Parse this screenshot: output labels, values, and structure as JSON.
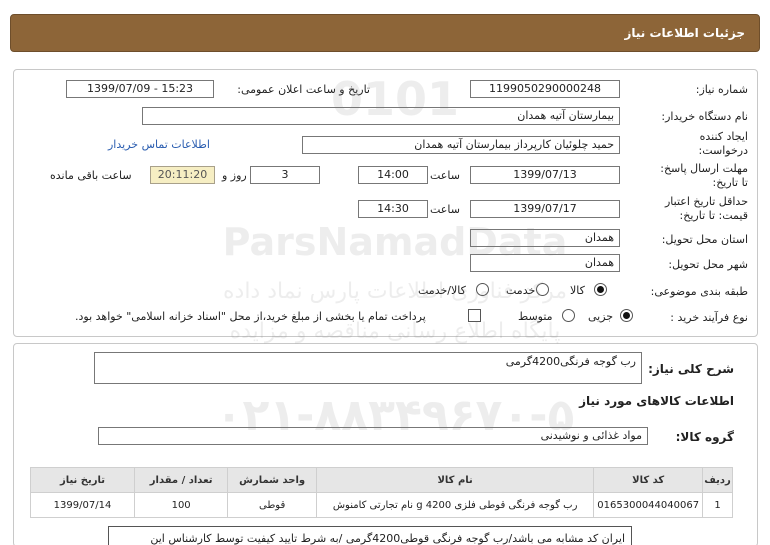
{
  "header": {
    "title": "جزئیات اطلاعات نیاز"
  },
  "need_number": {
    "label": "شماره نیاز:",
    "value": "1199050290000248"
  },
  "announce_datetime": {
    "label": "تاریخ و ساعت اعلان عمومی:",
    "value": "1399/07/09 - 15:23"
  },
  "buyer_org": {
    "label": "نام دستگاه خریدار:",
    "value": "بیمارستان آتیه همدان"
  },
  "requester": {
    "label_line1": "ایجاد کننده",
    "label_line2": "درخواست:",
    "value": "حمید چلوئیان  کارپرداز بیمارستان آتیه همدان",
    "contact_link": "اطلاعات تماس خریدار"
  },
  "response_deadline": {
    "label_line1": "مهلت ارسال پاسخ:",
    "label_line2": "تا تاریخ:",
    "date": "1399/07/13",
    "time_label": "ساعت",
    "time": "14:00",
    "days": "3",
    "days_label": "روز و",
    "remaining": "20:11:20",
    "remaining_label": "ساعت باقی مانده"
  },
  "price_validity": {
    "label_line1": "حداقل تاریخ اعتبار",
    "label_line2": "قیمت: تا تاریخ:",
    "date": "1399/07/17",
    "time_label": "ساعت",
    "time": "14:30"
  },
  "delivery_province": {
    "label": "استان محل تحویل:",
    "value": "همدان"
  },
  "delivery_city": {
    "label": "شهر محل تحویل:",
    "value": "همدان"
  },
  "category": {
    "label": "طبقه بندی موضوعی:",
    "options": [
      {
        "label": "کالا",
        "selected": true
      },
      {
        "label": "خدمت",
        "selected": false
      },
      {
        "label": "کالا/خدمت",
        "selected": false
      }
    ]
  },
  "purchase_process": {
    "label": "نوع فرآیند خرید :",
    "options": [
      {
        "label": "جزیی",
        "selected": true
      },
      {
        "label": "متوسط",
        "selected": false
      }
    ],
    "treasury_note": "پرداخت تمام یا بخشی از مبلغ خرید،از محل \"اسناد خزانه اسلامی\" خواهد بود."
  },
  "general_description": {
    "label": "شرح کلی نیاز:",
    "value": "رب گوجه فرنگی4200گرمی"
  },
  "items_section": {
    "title": "اطلاعات کالاهای مورد نیاز"
  },
  "goods_group": {
    "label": "گروه کالا:",
    "value": "مواد غذائی و نوشیدنی"
  },
  "table": {
    "headers": [
      "ردیف",
      "کد کالا",
      "نام کالا",
      "واحد شمارش",
      "تعداد / مقدار",
      "تاریخ نیاز"
    ],
    "rows": [
      [
        "1",
        "0165300044040067",
        "رب گوجه فرنگی قوطی فلزی 4200 g نام تجارتی کامنوش",
        "قوطی",
        "100",
        "1399/07/14"
      ]
    ]
  },
  "buyer_note": "ایران کد مشابه می باشد/رب گوجه فرنگی قوطی4200گرمی /به شرط تایید کیفیت توسط کارشناس این",
  "watermark": {
    "line_1": "ParsNamadData",
    "line_2": "مرکز فناوری اطلاعات پارس نماد داده",
    "line_3": "پایگاه اطلاع رسانی مناقصه و مزایده",
    "line_4": "۰۲۱-۸۸۳۴۹۶۷۰-۵"
  }
}
